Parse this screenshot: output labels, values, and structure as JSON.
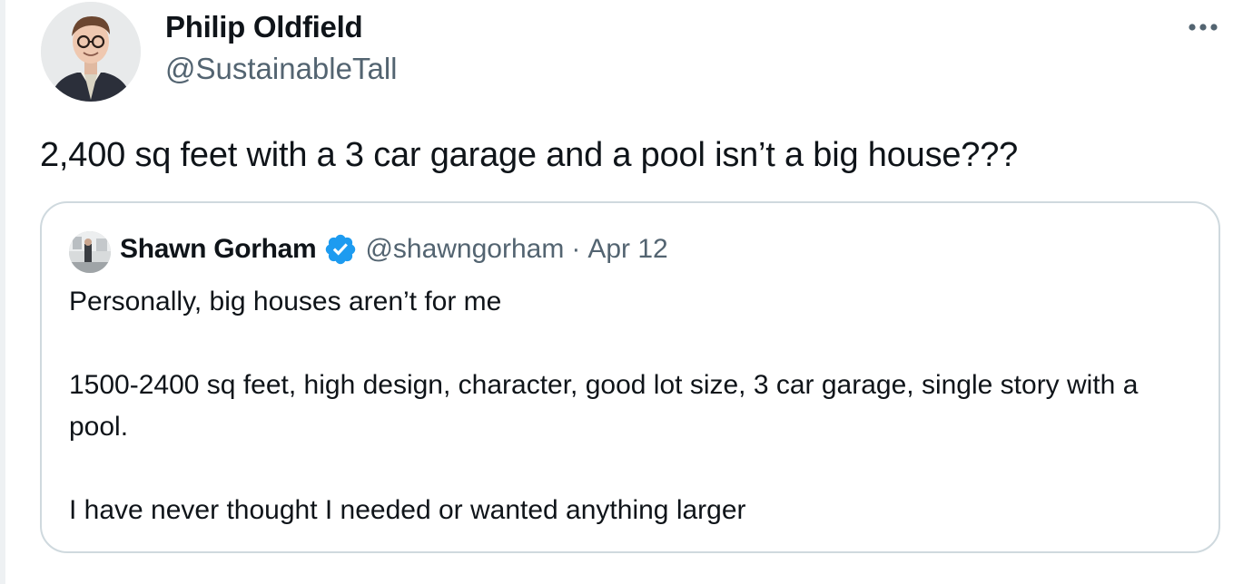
{
  "tweet": {
    "author": {
      "name": "Philip Oldfield",
      "handle": "@SustainableTall",
      "avatar_icon": "profile-photo-man-glasses"
    },
    "more_icon": "more-options-ellipsis-icon",
    "text": "2,400 sq feet with a 3 car garage and a pool isn’t a big house???",
    "quoted_tweet": {
      "author": {
        "name": "Shawn Gorham",
        "handle": "@shawngorham",
        "verified": true,
        "verified_color": "#1d9bf0",
        "avatar_icon": "profile-photo-interior"
      },
      "separator": "·",
      "date": "Apr 12",
      "paragraphs": [
        "Personally, big houses aren’t for me",
        "1500-2400 sq feet, high design, character, good lot size, 3 car garage, single story with a pool.",
        "I have never thought I needed or wanted anything larger"
      ]
    }
  },
  "colors": {
    "text_primary": "#0f1419",
    "text_secondary": "#536471",
    "border": "#cfd9de",
    "background": "#ffffff"
  }
}
